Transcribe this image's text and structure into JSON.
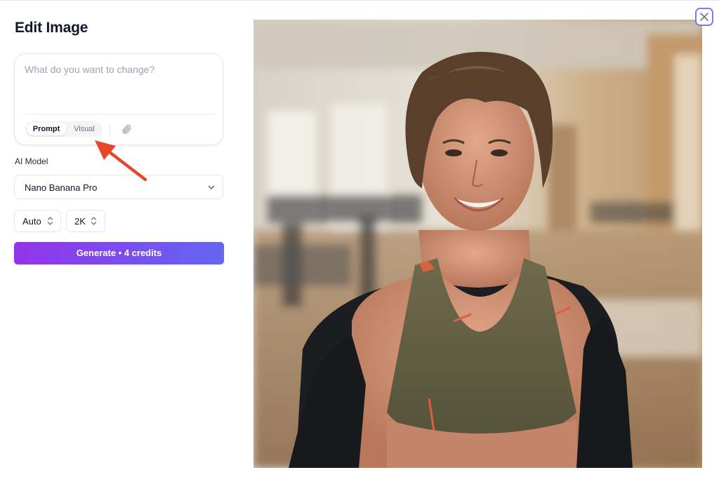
{
  "dialog": {
    "title": "Edit Image"
  },
  "prompt": {
    "value": "",
    "placeholder": "What do you want to change?",
    "mode_tabs": [
      {
        "label": "Prompt",
        "active": true
      },
      {
        "label": "Visual",
        "active": false
      }
    ],
    "attach_icon": "paperclip-icon"
  },
  "model": {
    "label": "AI Model",
    "selected": "Nano Banana Pro"
  },
  "options": {
    "aspect": "Auto",
    "resolution": "2K"
  },
  "generate": {
    "label": "Generate • 4 credits"
  },
  "annotation": {
    "arrow_color": "#e8452c",
    "arrow_icon": "arrow-pointer-icon"
  },
  "preview": {
    "image": "woman-gym-portrait"
  },
  "close_icon": "close-icon",
  "colors": {
    "accent_start": "#9333ea",
    "accent_end": "#6366f1",
    "close_border": "#7c7cf0"
  }
}
